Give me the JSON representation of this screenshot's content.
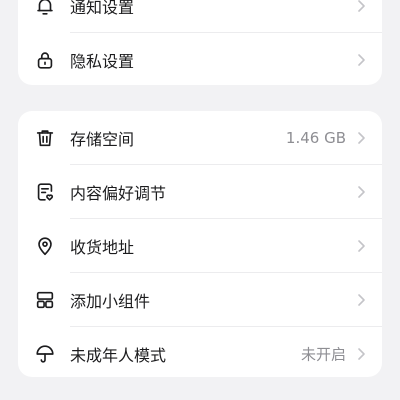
{
  "settings_group_1": {
    "items": [
      {
        "label": "通知设置",
        "icon": "bell-icon"
      },
      {
        "label": "隐私设置",
        "icon": "lock-icon"
      }
    ]
  },
  "settings_group_2": {
    "items": [
      {
        "label": "存储空间",
        "value": "1.46 GB",
        "icon": "trash-icon"
      },
      {
        "label": "内容偏好调节",
        "icon": "content-preference-icon"
      },
      {
        "label": "收货地址",
        "icon": "location-pin-icon"
      },
      {
        "label": "添加小组件",
        "icon": "widget-grid-icon"
      },
      {
        "label": "未成年人模式",
        "value": "未开启",
        "icon": "umbrella-icon"
      }
    ]
  },
  "colors": {
    "background": "#f2f2f4",
    "card": "#ffffff",
    "text": "#1c1c1e",
    "secondary_text": "#8e8e93",
    "chevron": "#c4c4c8"
  }
}
